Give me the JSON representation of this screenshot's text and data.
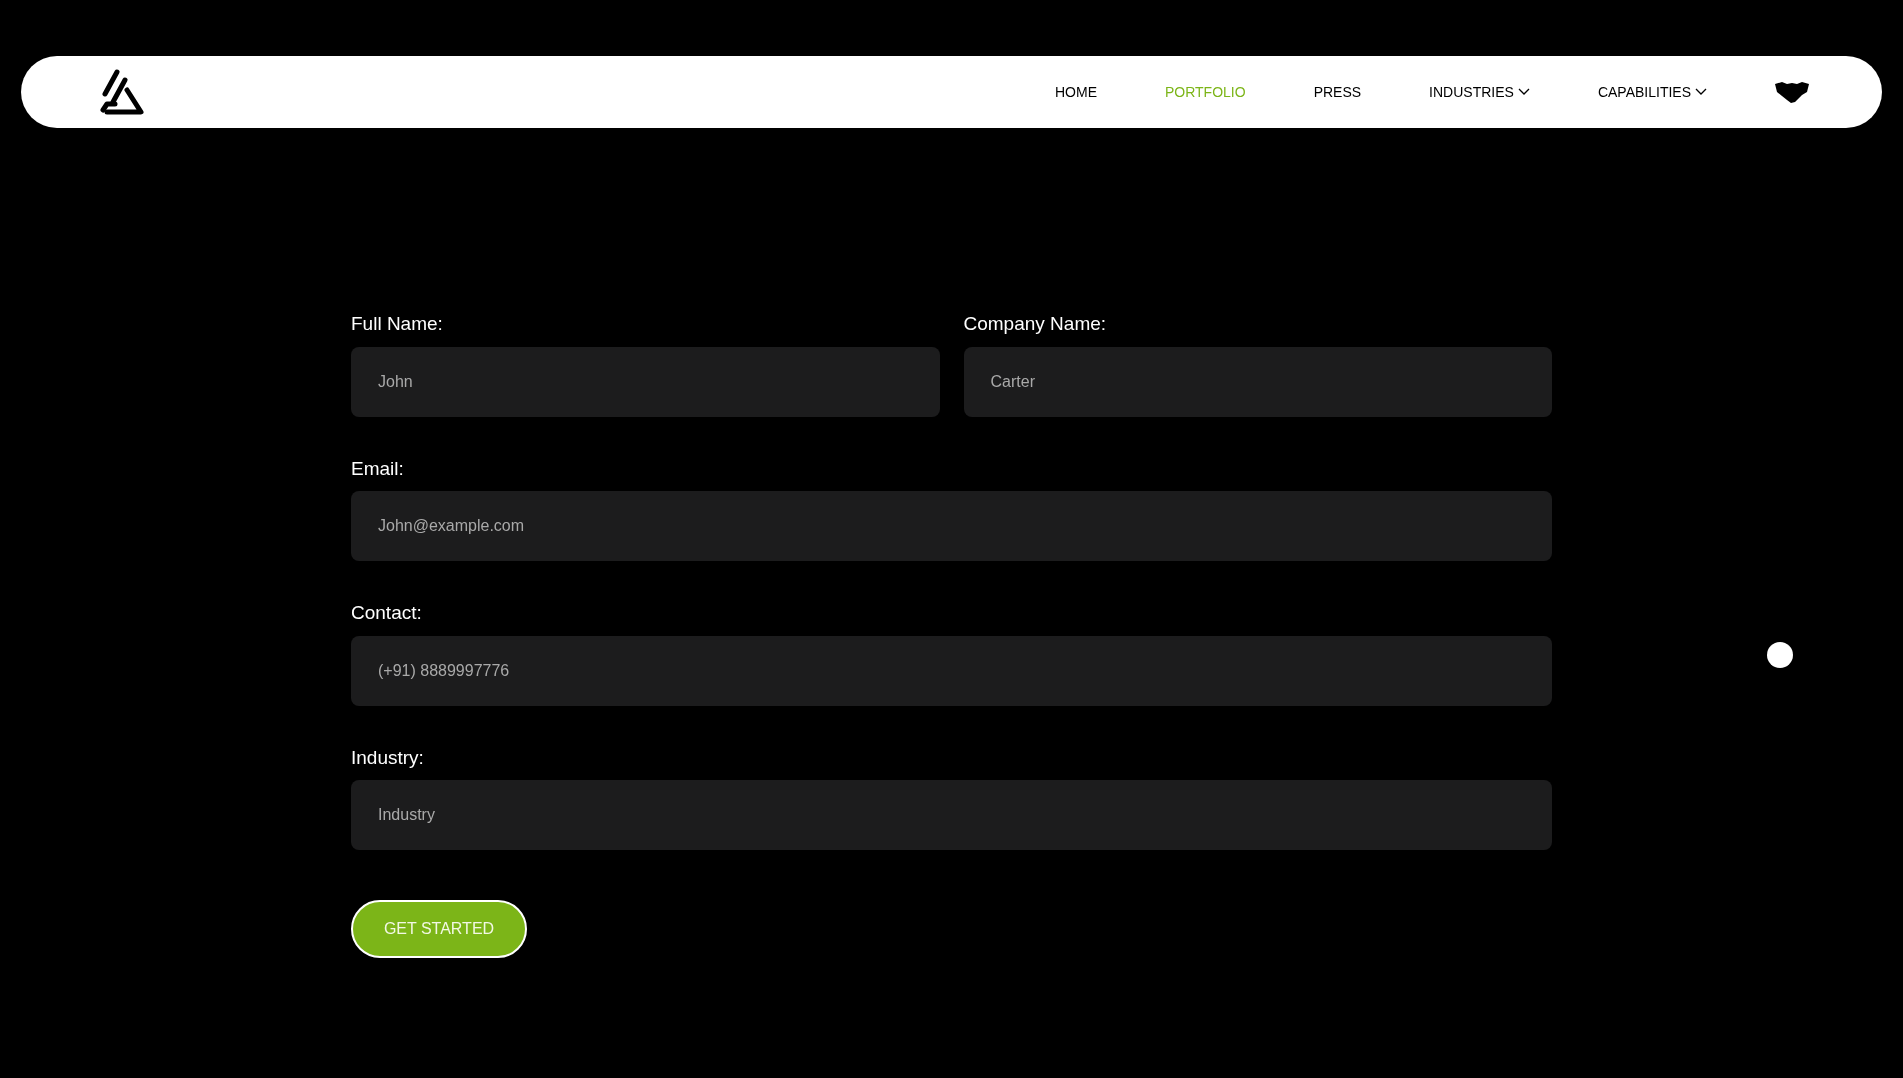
{
  "nav": {
    "items": [
      {
        "label": "HOME",
        "selected": false,
        "kind": "link"
      },
      {
        "label": "PORTFOLIO",
        "selected": true,
        "kind": "link"
      },
      {
        "label": "PRESS",
        "selected": false,
        "kind": "link"
      },
      {
        "label": "INDUSTRIES",
        "selected": false,
        "kind": "dropdown"
      },
      {
        "label": "CAPABILITIES",
        "selected": false,
        "kind": "dropdown"
      }
    ]
  },
  "form": {
    "rows": [
      [
        {
          "label": "Full Name:",
          "placeholder": "John"
        },
        {
          "label": "Company Name:",
          "placeholder": "Carter"
        }
      ],
      [
        {
          "label": "Email:",
          "placeholder": "John@example.com"
        }
      ],
      [
        {
          "label": "Contact:",
          "placeholder": "(+91) 8889997776"
        }
      ],
      [
        {
          "label": "Industry:",
          "placeholder": "Industry"
        }
      ]
    ],
    "submit": "GET STARTED"
  }
}
